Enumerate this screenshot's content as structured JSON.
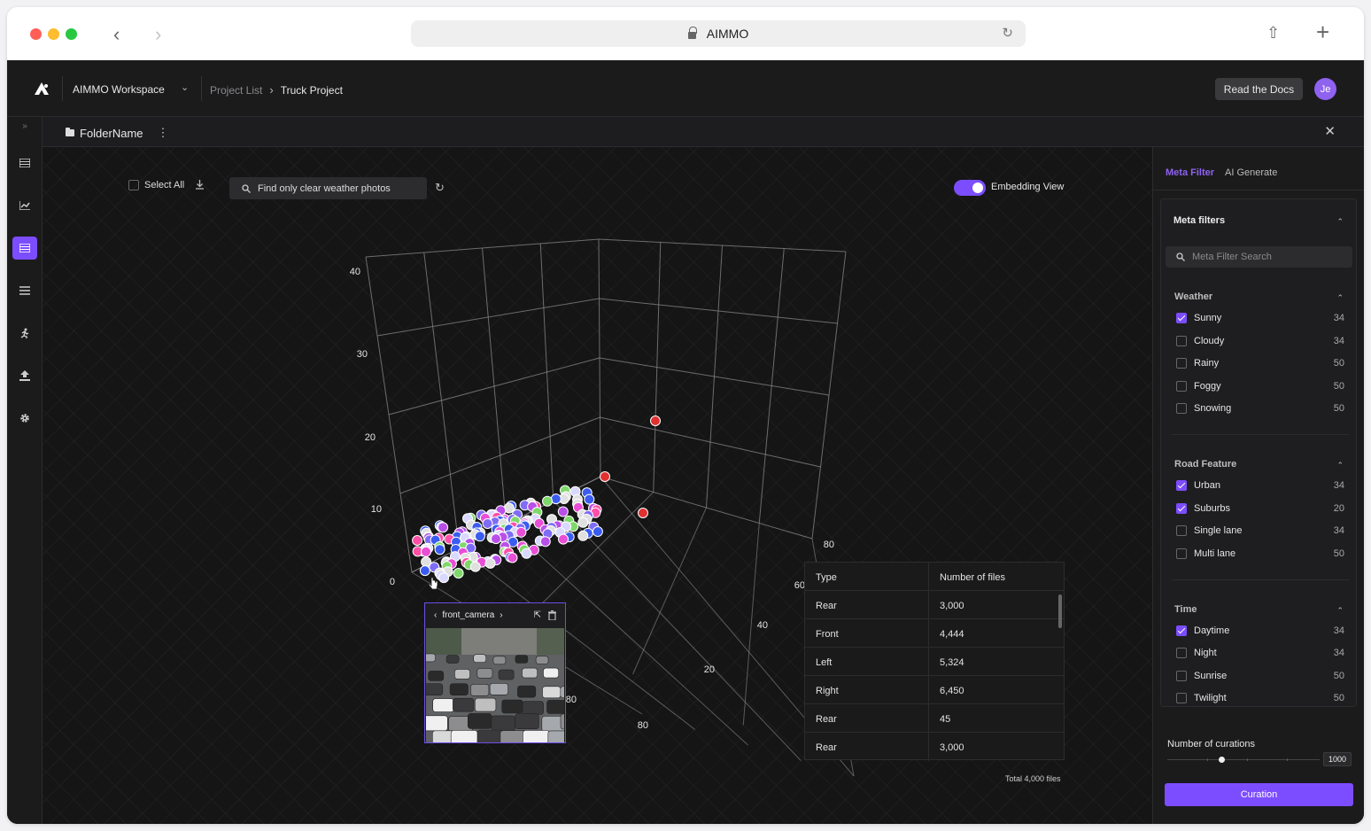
{
  "browser": {
    "url": "AIMMO",
    "traffic_lights": {
      "close": "#ff5f57",
      "minimize": "#febc2e",
      "maximize": "#28c840"
    }
  },
  "header": {
    "workspace": "AIMMO Workspace",
    "breadcrumb": {
      "parent": "Project List",
      "current": "Truck Project"
    },
    "docs_button": "Read the Docs",
    "avatar_initials": "Je"
  },
  "sidebar": {
    "items": [
      {
        "icon": "list-icon"
      },
      {
        "icon": "chart-icon"
      },
      {
        "icon": "table-icon",
        "active": true
      },
      {
        "icon": "menu-icon"
      },
      {
        "icon": "run-icon"
      },
      {
        "icon": "upload-icon"
      },
      {
        "icon": "gear-icon"
      }
    ]
  },
  "folder": {
    "name": "FolderName"
  },
  "toolbar": {
    "select_all": "Select All",
    "search_value": "Find only clear weather photos",
    "embedding_label": "Embedding View",
    "embedding_on": true
  },
  "plot": {
    "z_ticks": [
      "40",
      "30",
      "20",
      "10",
      "0"
    ],
    "y_ticks": [
      "80",
      "60"
    ],
    "x_ticks": [
      "40",
      "20",
      "80",
      "80"
    ],
    "point_colors": [
      "#e0e0e0",
      "#e84ed6",
      "#7f6cf6",
      "#3b5cf0",
      "#7fd86a",
      "#d9d9ff",
      "#b94fe8",
      "#ff4fa8"
    ],
    "outlier_color": "#e03030"
  },
  "preview": {
    "camera": "front_camera"
  },
  "table": {
    "headers": [
      "Type",
      "Number of files"
    ],
    "rows": [
      [
        "Rear",
        "3,000"
      ],
      [
        "Front",
        "4,444"
      ],
      [
        "Left",
        "5,324"
      ],
      [
        "Right",
        "6,450"
      ],
      [
        "Rear",
        "45"
      ],
      [
        "Rear",
        "3,000"
      ]
    ],
    "total": "Total 4,000 files"
  },
  "right_panel": {
    "tabs": [
      "Meta Filter",
      "AI Generate"
    ],
    "title": "Meta filters",
    "search_placeholder": "Meta Filter Search",
    "groups": [
      {
        "title": "Weather",
        "options": [
          {
            "label": "Sunny",
            "count": "34",
            "checked": true
          },
          {
            "label": "Cloudy",
            "count": "34",
            "checked": false
          },
          {
            "label": "Rainy",
            "count": "50",
            "checked": false
          },
          {
            "label": "Foggy",
            "count": "50",
            "checked": false
          },
          {
            "label": "Snowing",
            "count": "50",
            "checked": false
          }
        ]
      },
      {
        "title": "Road Feature",
        "options": [
          {
            "label": "Urban",
            "count": "34",
            "checked": true
          },
          {
            "label": "Suburbs",
            "count": "20",
            "checked": true
          },
          {
            "label": "Single lane",
            "count": "34",
            "checked": false
          },
          {
            "label": "Multi lane",
            "count": "50",
            "checked": false
          }
        ]
      },
      {
        "title": "Time",
        "options": [
          {
            "label": "Daytime",
            "count": "34",
            "checked": true
          },
          {
            "label": "Night",
            "count": "34",
            "checked": false
          },
          {
            "label": "Sunrise",
            "count": "50",
            "checked": false
          },
          {
            "label": "Twilight",
            "count": "50",
            "checked": false
          }
        ]
      }
    ],
    "curations_label": "Number of curations",
    "curations_max": "1000",
    "curation_button": "Curation",
    "accent": "#7c4dff"
  }
}
